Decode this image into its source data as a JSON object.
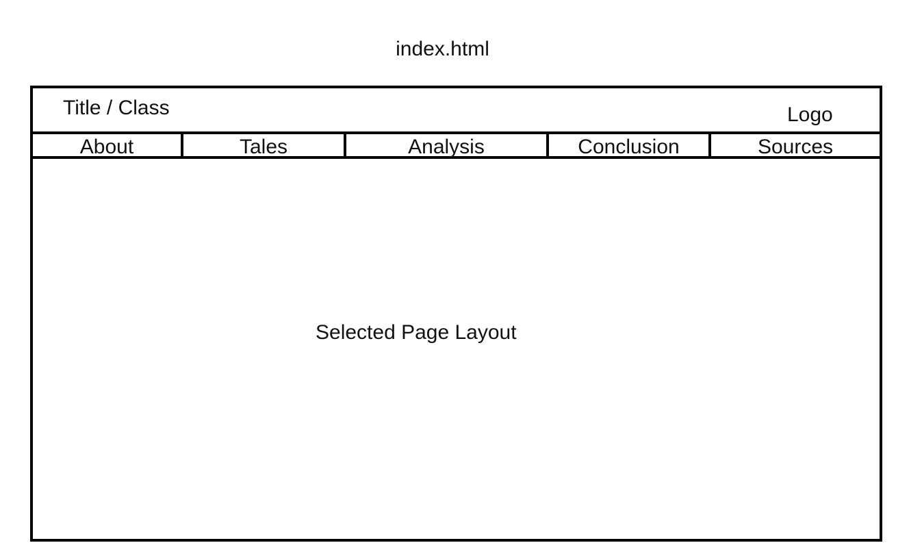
{
  "file_label": "index.html",
  "header": {
    "title": "Title / Class",
    "logo": "Logo"
  },
  "nav": {
    "items": [
      {
        "label": "About"
      },
      {
        "label": "Tales"
      },
      {
        "label": "Analysis"
      },
      {
        "label": "Conclusion"
      },
      {
        "label": "Sources"
      }
    ]
  },
  "content": {
    "label": "Selected Page Layout"
  }
}
